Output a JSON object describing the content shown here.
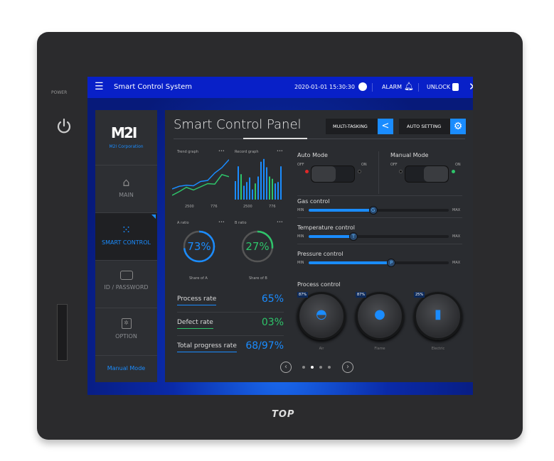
{
  "device": {
    "power_label": "POWER",
    "brand": "TOP"
  },
  "topbar": {
    "title": "Smart Control System",
    "datetime": "2020-01-01  15:30:30",
    "alarm": "ALARM",
    "unlock": "UNLOCK"
  },
  "sidebar": {
    "logo": "M2I",
    "company": "M2I Corporation",
    "items": [
      {
        "label": "MAIN",
        "icon": "home-icon"
      },
      {
        "label": "SMART CONTROL",
        "icon": "spinner-icon",
        "active": true
      },
      {
        "label": "ID / PASSWORD",
        "icon": "id-card-icon"
      },
      {
        "label": "OPTION",
        "icon": "gear-icon"
      }
    ],
    "mode": "Manual Mode"
  },
  "main": {
    "title": "Smart Control Panel",
    "multitasking": "MULTI-TASKING",
    "auto_setting": "AUTO SETTING",
    "trend": {
      "title": "Trend graph",
      "more": "•••",
      "tick_a": "2500",
      "tick_b": "776",
      "line1": [
        20,
        25,
        27,
        26,
        34,
        36,
        50,
        60,
        75
      ],
      "line2": [
        8,
        15,
        23,
        18,
        24,
        30,
        29,
        47,
        43
      ]
    },
    "record": {
      "title": "Record graph",
      "more": "•••",
      "tick_a": "2500",
      "tick_b": "776",
      "bars": [
        40,
        72,
        55,
        30,
        38,
        48,
        22,
        35,
        50,
        82,
        88,
        70,
        50,
        45,
        35,
        38,
        72
      ],
      "green_idx": [
        2,
        7,
        12,
        13
      ]
    },
    "ratio_a": {
      "title": "A ratio",
      "more": "•••",
      "value": "73%",
      "fraction": 0.73,
      "caption": "Share of A"
    },
    "ratio_b": {
      "title": "B ratio",
      "more": "•••",
      "value": "27%",
      "fraction": 0.27,
      "caption": "Share of B"
    },
    "rates": [
      {
        "label": "Process rate",
        "value": "65%",
        "color": "#1a8cff"
      },
      {
        "label": "Defect rate",
        "value": "03%",
        "color": "#2ec46a"
      },
      {
        "label": "Total progress rate",
        "value": "68/97%",
        "color": "#1a8cff"
      }
    ],
    "auto_mode": {
      "label": "Auto Mode",
      "off": "OFF",
      "on": "ON",
      "state": "off"
    },
    "manual_mode": {
      "label": "Manual Mode",
      "off": "OFF",
      "on": "ON",
      "state": "on"
    },
    "sliders": [
      {
        "label": "Gas control",
        "knob": "G",
        "value": 0.46
      },
      {
        "label": "Temperature control",
        "knob": "T",
        "value": 0.32
      },
      {
        "label": "Pressure control",
        "knob": "P",
        "value": 0.59
      }
    ],
    "min": "MIN",
    "max": "MAX",
    "process": {
      "label": "Process control",
      "dials": [
        {
          "label": "Air",
          "percent": "87%"
        },
        {
          "label": "Flame",
          "percent": "87%"
        },
        {
          "label": "Electric",
          "percent": "25%"
        }
      ]
    },
    "pager": {
      "pages": 4,
      "current": 1
    }
  }
}
